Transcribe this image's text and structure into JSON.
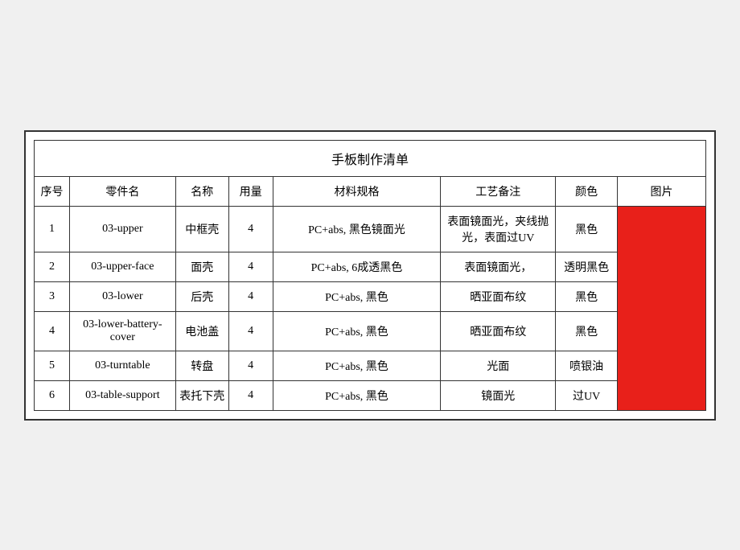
{
  "title": "手板制作清单",
  "headers": {
    "seq": "序号",
    "part_id": "零件名",
    "name": "名称",
    "qty": "用量",
    "spec": "材料规格",
    "process": "工艺备注",
    "color": "颜色",
    "image": "图片"
  },
  "rows": [
    {
      "seq": "1",
      "part_id": "03-upper",
      "name": "中框壳",
      "qty": "4",
      "spec": "PC+abs, 黑色镜面光",
      "process": "表面镜面光，夹线抛光，表面过UV",
      "color": "黑色"
    },
    {
      "seq": "2",
      "part_id": "03-upper-face",
      "name": "面壳",
      "qty": "4",
      "spec": "PC+abs, 6成透黑色",
      "process": "表面镜面光，",
      "color": "透明黑色"
    },
    {
      "seq": "3",
      "part_id": "03-lower",
      "name": "后壳",
      "qty": "4",
      "spec": "PC+abs, 黑色",
      "process": "晒亚面布纹",
      "color": "黑色"
    },
    {
      "seq": "4",
      "part_id": "03-lower-battery-cover",
      "name": "电池盖",
      "qty": "4",
      "spec": "PC+abs, 黑色",
      "process": "晒亚面布纹",
      "color": "黑色"
    },
    {
      "seq": "5",
      "part_id": "03-turntable",
      "name": "转盘",
      "qty": "4",
      "spec": "PC+abs, 黑色",
      "process": "光面",
      "color": "喷银油"
    },
    {
      "seq": "6",
      "part_id": "03-table-support",
      "name": "表托下壳",
      "qty": "4",
      "spec": "PC+abs, 黑色",
      "process": "镜面光",
      "color": "过UV"
    }
  ]
}
